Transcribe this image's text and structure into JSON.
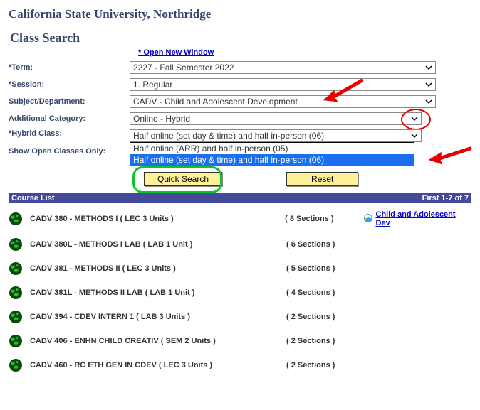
{
  "header": {
    "institution": "California State University, Northridge",
    "page_title": "Class Search",
    "open_new_window": "* Open New Window"
  },
  "form": {
    "term_label": "*Term:",
    "term_value": "2227 - Fall Semester 2022",
    "session_label": "*Session:",
    "session_value": "1. Regular",
    "subject_label": "Subject/Department:",
    "subject_value": "CADV - Child and Adolescent Development",
    "category_label": "Additional Category:",
    "category_value": "Online - Hybrid",
    "hybrid_label": "*Hybrid Class:",
    "hybrid_value": "Half online (set day & time) and half in-person (06)",
    "hybrid_options": {
      "opt0": "Half online (ARR) and half in-person (05)",
      "opt1": "Half online (set day & time) and half in-person (06)"
    },
    "show_open_label": "Show Open Classes Only:"
  },
  "buttons": {
    "quick_search": "Quick Search",
    "reset": "Reset"
  },
  "course_list": {
    "heading_left": "Course List",
    "heading_right": "First 1-7 of 7",
    "dept_link": "Child and Adolescent Dev",
    "rows": {
      "r1_title": "CADV 380 - METHODS I ( LEC  3 Units )",
      "r1_sect": "( 8 Sections )",
      "r2_title": "CADV 380L - METHODS I LAB ( LAB  1 Unit )",
      "r2_sect": "( 6 Sections )",
      "r3_title": "CADV 381 - METHODS II ( LEC  3 Units )",
      "r3_sect": "( 5 Sections )",
      "r4_title": "CADV 381L - METHODS II LAB ( LAB  1 Unit )",
      "r4_sect": "( 4 Sections )",
      "r5_title": "CADV 394 - CDEV INTERN 1 ( LAB  3 Units )",
      "r5_sect": "( 2 Sections )",
      "r6_title": "CADV 406 - ENHN CHILD CREATIV ( SEM  2 Units )",
      "r6_sect": "( 2 Sections )",
      "r7_title": "CADV 460 - RC ETH GEN IN CDEV ( LEC  3 Units )",
      "r7_sect": "( 2 Sections )"
    }
  }
}
